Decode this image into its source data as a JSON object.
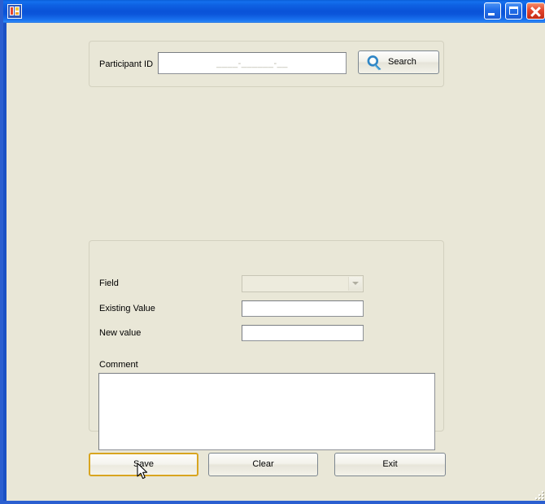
{
  "window": {
    "title": "",
    "icon": "application-icon",
    "controls": {
      "minimize": "Minimize",
      "maximize": "Maximize",
      "close": "Close"
    }
  },
  "search_panel": {
    "participant_label": "Participant ID",
    "participant_value": "____-______-__",
    "participant_placeholder": "____-______-__",
    "search_button": "Search",
    "search_icon": "magnifier-icon"
  },
  "edit_panel": {
    "field_label": "Field",
    "field_value": "",
    "field_icon": "chevron-down-icon",
    "existing_value_label": "Existing Value",
    "existing_value": "",
    "new_value_label": "New value",
    "new_value": "",
    "comment_label": "Comment",
    "comment_value": ""
  },
  "actions": {
    "save": "Save",
    "clear": "Clear",
    "exit": "Exit"
  },
  "colors": {
    "titlebar_blue": "#0a53d8",
    "window_border": "#2b5fd0",
    "client_background": "#e9e7d7",
    "focus_border": "#d8a520",
    "close_red": "#e4452c",
    "search_icon_blue": "#3e9ad4"
  }
}
